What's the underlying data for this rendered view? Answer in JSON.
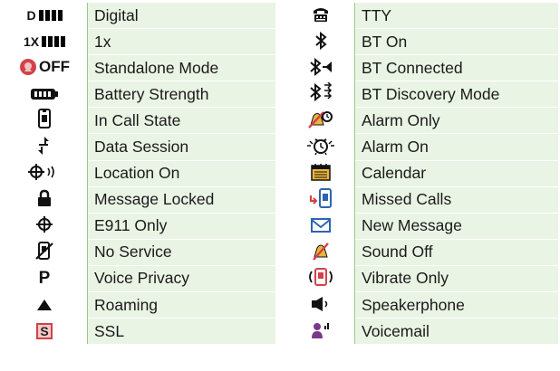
{
  "left": [
    {
      "icon": "digital-signal-icon",
      "glyph": "D",
      "label": "Digital"
    },
    {
      "icon": "1x-signal-icon",
      "glyph": "1X",
      "label": "1x"
    },
    {
      "icon": "standalone-off-icon",
      "glyph": "OFF",
      "label": "Standalone Mode"
    },
    {
      "icon": "battery-icon",
      "label": "Battery Strength"
    },
    {
      "icon": "in-call-icon",
      "label": "In Call State"
    },
    {
      "icon": "data-session-arrows-icon",
      "label": "Data Session"
    },
    {
      "icon": "location-on-icon",
      "label": "Location On"
    },
    {
      "icon": "padlock-icon",
      "label": "Message Locked"
    },
    {
      "icon": "e911-crosshair-icon",
      "label": "E911 Only"
    },
    {
      "icon": "no-service-icon",
      "label": "No Service"
    },
    {
      "icon": "voice-privacy-icon",
      "glyph": "P",
      "label": "Voice Privacy"
    },
    {
      "icon": "roaming-triangle-icon",
      "label": "Roaming"
    },
    {
      "icon": "ssl-icon",
      "glyph": "S",
      "label": "SSL"
    }
  ],
  "right": [
    {
      "icon": "tty-icon",
      "label": "TTY"
    },
    {
      "icon": "bluetooth-icon",
      "label": "BT On"
    },
    {
      "icon": "bluetooth-connected-icon",
      "label": "BT Connected"
    },
    {
      "icon": "bluetooth-discovery-icon",
      "label": "BT Discovery Mode"
    },
    {
      "icon": "alarm-only-icon",
      "label": "Alarm Only"
    },
    {
      "icon": "alarm-on-icon",
      "label": "Alarm On"
    },
    {
      "icon": "calendar-icon",
      "label": "Calendar"
    },
    {
      "icon": "missed-calls-icon",
      "label": "Missed Calls"
    },
    {
      "icon": "envelope-icon",
      "label": "New Message"
    },
    {
      "icon": "sound-off-icon",
      "label": "Sound Off"
    },
    {
      "icon": "vibrate-only-icon",
      "label": "Vibrate Only"
    },
    {
      "icon": "speakerphone-icon",
      "label": "Speakerphone"
    },
    {
      "icon": "voicemail-icon",
      "label": "Voicemail"
    }
  ],
  "colors": {
    "label_background": "#eaf4e5",
    "divider": "#9bc98a",
    "accent_red": "#d1424a",
    "accent_blue": "#2f64b0",
    "accent_yellow": "#e9b63a"
  }
}
